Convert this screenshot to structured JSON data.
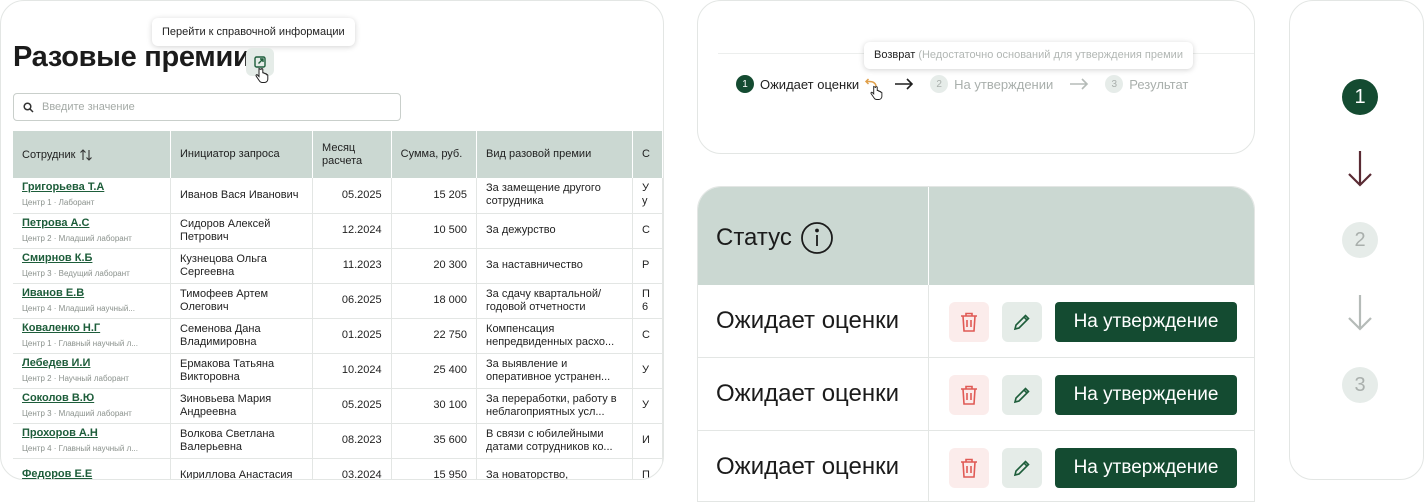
{
  "reference_tooltip": "Перейти к справочной информации",
  "page_title": "Разовые премии",
  "search": {
    "placeholder": "Введите значение"
  },
  "table": {
    "columns": [
      "Сотрудник",
      "Инициатор запроса",
      "Месяц расчета",
      "Сумма, руб.",
      "Вид разовой премии",
      "С"
    ],
    "rows": [
      {
        "name": "Григорьева Т.А",
        "sub": "Центр 1 · Лаборант",
        "initiator": "Иванов Вася Иванович",
        "month": "05.2025",
        "sum": "15 205",
        "type": "За замещение другого сотрудника",
        "extra": "У у"
      },
      {
        "name": "Петрова А.С",
        "sub": "Центр 2 · Младший лаборант",
        "initiator": "Сидоров Алексей Петрович",
        "month": "12.2024",
        "sum": "10 500",
        "type": "За дежурство",
        "extra": "С"
      },
      {
        "name": "Смирнов К.Б",
        "sub": "Центр 3 · Ведущий лаборант",
        "initiator": "Кузнецова Ольга Сергеевна",
        "month": "11.2023",
        "sum": "20 300",
        "type": "За наставничество",
        "extra": "Р"
      },
      {
        "name": "Иванов Е.В",
        "sub": "Центр 4 · Младший научный...",
        "initiator": "Тимофеев Артем Олегович",
        "month": "06.2025",
        "sum": "18 000",
        "type": "За сдачу квартальной/годовой отчетности",
        "extra": "П 6"
      },
      {
        "name": "Коваленко Н.Г",
        "sub": "Центр 1 · Главный научный л...",
        "initiator": "Семенова Дана Владимировна",
        "month": "01.2025",
        "sum": "22 750",
        "type": "Компенсация непредвиденных расхо...",
        "extra": "С"
      },
      {
        "name": "Лебедев И.И",
        "sub": "Центр 2 · Научный лаборант",
        "initiator": "Ермакова Татьяна Викторовна",
        "month": "10.2024",
        "sum": "25 400",
        "type": "За выявление и оперативное устранен...",
        "extra": "У"
      },
      {
        "name": "Соколов В.Ю",
        "sub": "Центр 3 · Младший лаборант",
        "initiator": "Зиновьева Мария Андреевна",
        "month": "05.2025",
        "sum": "30 100",
        "type": "За переработки, работу в неблагоприятных усл...",
        "extra": "У"
      },
      {
        "name": "Прохоров А.Н",
        "sub": "Центр 4 · Главный научный л...",
        "initiator": "Волкова Светлана Валерьевна",
        "month": "08.2023",
        "sum": "35 600",
        "type": "В связи с юбилейными датами сотрудников ко...",
        "extra": "И"
      },
      {
        "name": "Федоров Е.Е",
        "sub": "",
        "initiator": "Кириллова Анастасия",
        "month": "03.2024",
        "sum": "15 950",
        "type": "За новаторство,",
        "extra": "П"
      }
    ]
  },
  "stepper": {
    "tooltip_title": "Возврат",
    "tooltip_detail": "(Недостаточно оснований для утверждения премии",
    "steps": [
      {
        "num": "1",
        "label": "Ожидает оценки",
        "state": "active"
      },
      {
        "num": "2",
        "label": "На утверждении",
        "state": "inactive"
      },
      {
        "num": "3",
        "label": "Результат",
        "state": "inactive"
      }
    ]
  },
  "status_table": {
    "header": "Статус",
    "rows": [
      {
        "status": "Ожидает оценки",
        "action": "На утверждение"
      },
      {
        "status": "Ожидает оценки",
        "action": "На утверждение"
      },
      {
        "status": "Ожидает оценки",
        "action": "На утверждение"
      }
    ]
  },
  "vertical_stepper": {
    "steps": [
      "1",
      "2",
      "3"
    ]
  },
  "colors": {
    "primary": "#144b31",
    "header_bg": "#cbd8d2",
    "link": "#1d5d3a",
    "delete": "#e05a55",
    "return_arrow": "#e0a04a"
  }
}
